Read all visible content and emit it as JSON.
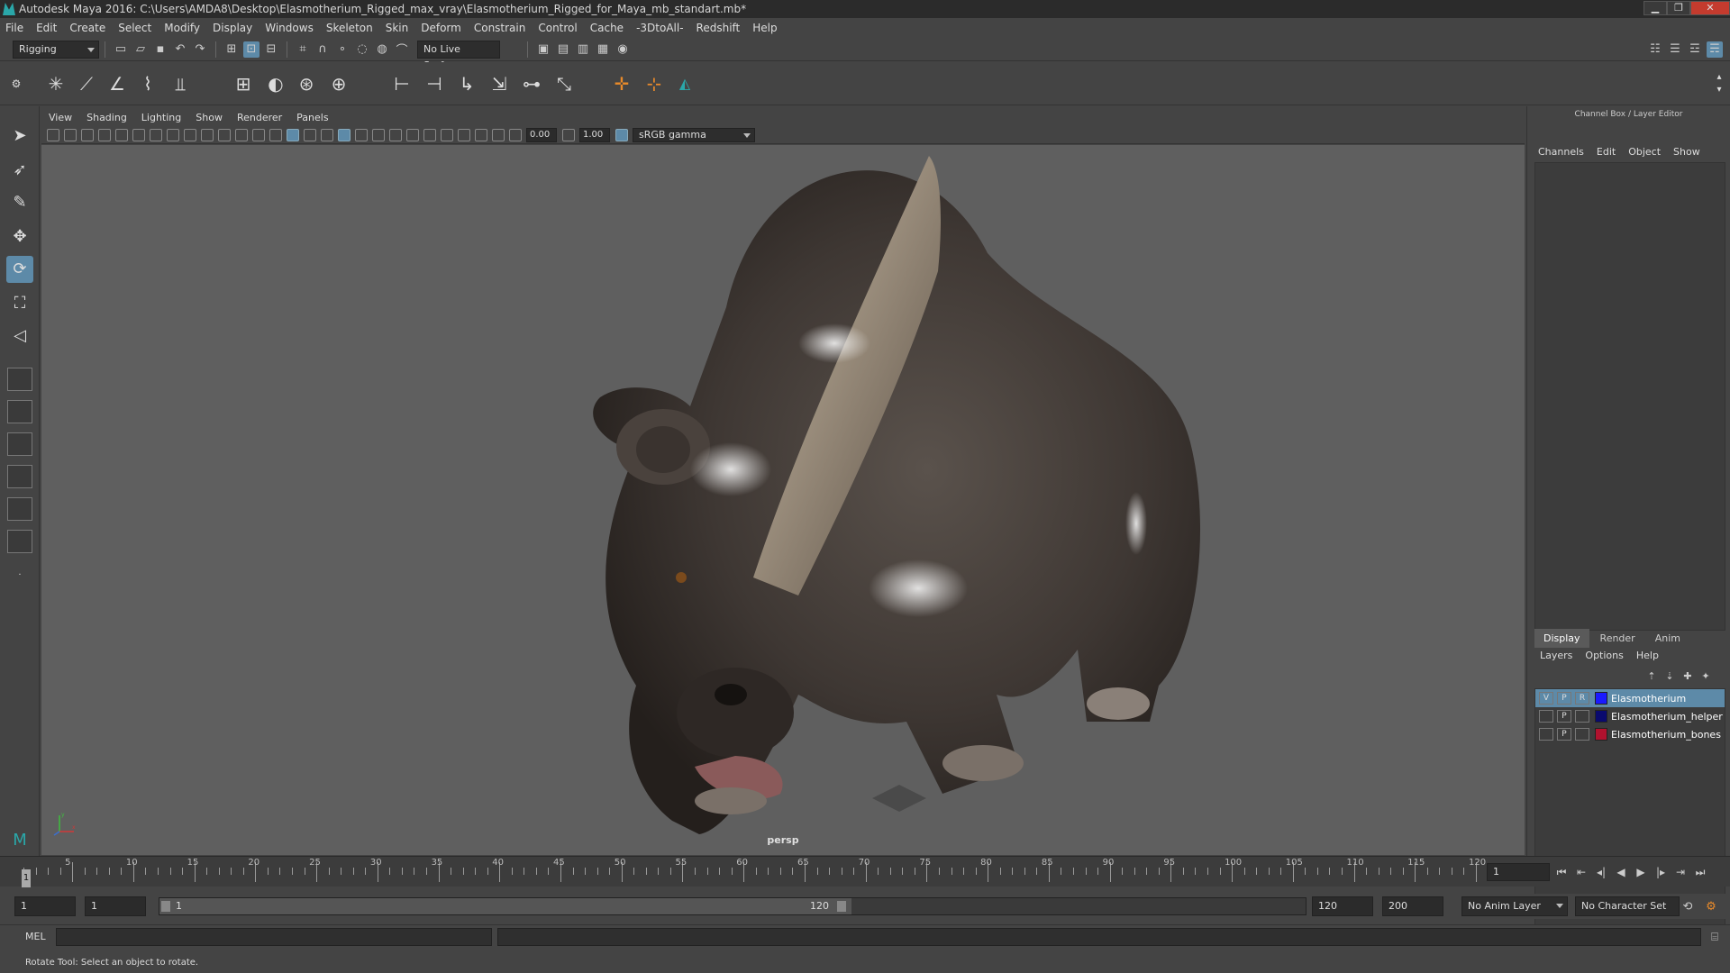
{
  "window": {
    "title": "Autodesk Maya 2016: C:\\Users\\AMDA8\\Desktop\\Elasmotherium_Rigged_max_vray\\Elasmotherium_Rigged_for_Maya_mb_standart.mb*",
    "minimize": "▁",
    "maximize": "❐",
    "close": "✕"
  },
  "menubar": [
    "File",
    "Edit",
    "Create",
    "Select",
    "Modify",
    "Display",
    "Windows",
    "Skeleton",
    "Skin",
    "Deform",
    "Constrain",
    "Control",
    "Cache",
    "-3DtoAll-",
    "Redshift",
    "Help"
  ],
  "statusline": {
    "menuset": "Rigging",
    "live_surface": "No Live Surface"
  },
  "viewport": {
    "menu": [
      "View",
      "Shading",
      "Lighting",
      "Show",
      "Renderer",
      "Panels"
    ],
    "exposure": "0.00",
    "gamma": "1.00",
    "color_space": "sRGB gamma",
    "camera_label": "persp",
    "axis_y": "y",
    "axis_x": "x"
  },
  "channelbox": {
    "title": "Channel Box / Layer Editor",
    "menu": [
      "Channels",
      "Edit",
      "Object",
      "Show"
    ],
    "tabs": [
      "Display",
      "Render",
      "Anim"
    ],
    "selected_tab": "Display",
    "layer_menu": [
      "Layers",
      "Options",
      "Help"
    ],
    "layers": [
      {
        "name": "Elasmotherium",
        "v": "V",
        "p": "P",
        "r": "R",
        "color": "#1a1aff",
        "selected": true
      },
      {
        "name": "Elasmotherium_helper",
        "v": "",
        "p": "P",
        "r": "",
        "color": "#0a0a6e",
        "selected": false
      },
      {
        "name": "Elasmotherium_bones",
        "v": "",
        "p": "P",
        "r": "",
        "color": "#b0122e",
        "selected": false
      }
    ]
  },
  "timeslider": {
    "ticks": [
      "1",
      "5",
      "10",
      "15",
      "20",
      "25",
      "30",
      "35",
      "40",
      "45",
      "50",
      "55",
      "60",
      "65",
      "70",
      "75",
      "80",
      "85",
      "90",
      "95",
      "100",
      "105",
      "110",
      "115",
      "120"
    ],
    "current_frame": "1",
    "frame_field": "1"
  },
  "rangeslider": {
    "start": "1",
    "playback_start": "1",
    "bar_start": "1",
    "bar_end": "120",
    "playback_end": "120",
    "end": "200",
    "anim_layer": "No Anim Layer",
    "character_set": "No Character Set"
  },
  "cmdline": {
    "label": "MEL"
  },
  "helpline": {
    "text": "Rotate Tool: Select an object to rotate."
  }
}
